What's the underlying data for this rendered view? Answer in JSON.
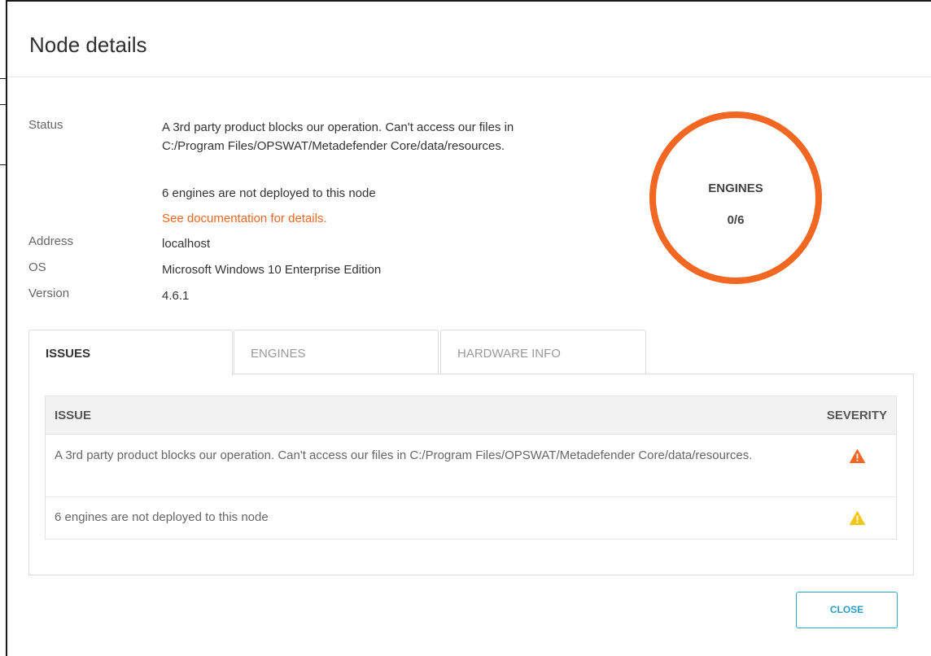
{
  "dialog": {
    "title": "Node details",
    "close_label": "CLOSE"
  },
  "details": {
    "status_label": "Status",
    "status_message": "A 3rd party product blocks our operation. Can't access our files in C:/Program Files/OPSWAT/Metadefender Core/data/resources.",
    "engines_message": "6 engines are not deployed to this node",
    "doc_link": "See documentation for details.",
    "address_label": "Address",
    "address_value": "localhost",
    "os_label": "OS",
    "os_value": "Microsoft Windows 10 Enterprise Edition",
    "version_label": "Version",
    "version_value": "4.6.1"
  },
  "engines_ring": {
    "label": "ENGINES",
    "value": "0/6",
    "color": "#f26722"
  },
  "tabs": [
    {
      "label": "ISSUES",
      "active": true
    },
    {
      "label": "ENGINES",
      "active": false
    },
    {
      "label": "HARDWARE INFO",
      "active": false
    }
  ],
  "issues_table": {
    "columns": [
      "ISSUE",
      "SEVERITY"
    ],
    "rows": [
      {
        "issue": "A 3rd party product blocks our operation. Can't access our files in C:/Program Files/OPSWAT/Metadefender Core/data/resources.",
        "severity_icon": "warning-triangle-icon",
        "severity_color": "#f26722"
      },
      {
        "issue": "6 engines are not deployed to this node",
        "severity_icon": "warning-triangle-icon",
        "severity_color": "#f5c518"
      }
    ]
  },
  "colors": {
    "accent": "#f26722",
    "link": "#f26722",
    "button": "#2a9fc4"
  }
}
